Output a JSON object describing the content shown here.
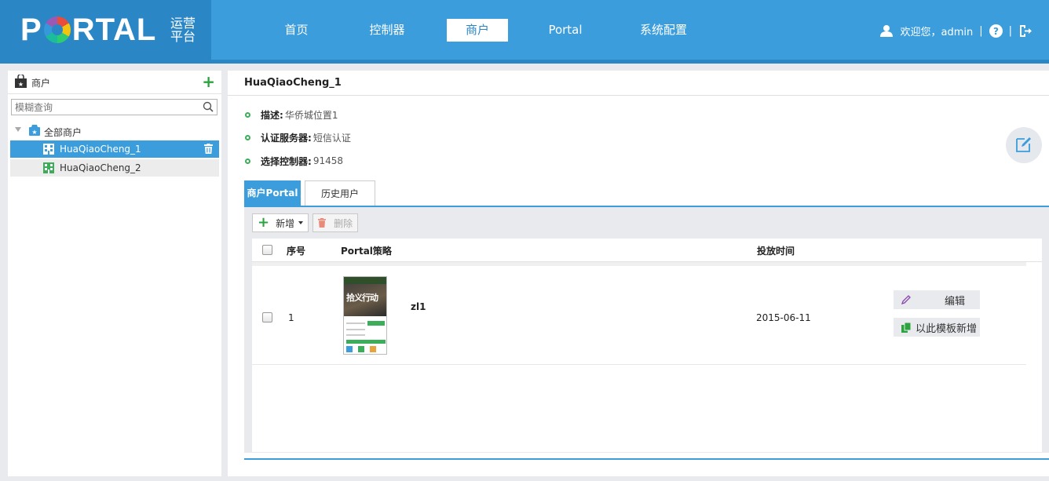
{
  "header": {
    "logo": {
      "main_left": "P",
      "main_right": "RTAL",
      "sub_line1": "运营",
      "sub_line2": "平台"
    },
    "nav": [
      {
        "label": "首页",
        "active": false
      },
      {
        "label": "控制器",
        "active": false
      },
      {
        "label": "商户",
        "active": true
      },
      {
        "label": "Portal",
        "active": false
      },
      {
        "label": "系统配置",
        "active": false
      }
    ],
    "user": {
      "greeting": "欢迎您，admin",
      "separator": "|"
    }
  },
  "sidebar": {
    "title": "商户",
    "search_placeholder": "模糊查询",
    "root_label": "全部商户",
    "items": [
      {
        "label": "HuaQiaoCheng_1",
        "selected": true
      },
      {
        "label": "HuaQiaoCheng_2",
        "selected": false
      }
    ]
  },
  "detail": {
    "title": "HuaQiaoCheng_1",
    "fields": [
      {
        "key": "描述:",
        "value": "华侨城位置1"
      },
      {
        "key": "认证服务器:",
        "value": "短信认证"
      },
      {
        "key": "选择控制器:",
        "value": "91458"
      }
    ],
    "tabs": [
      {
        "label": "商户Portal",
        "active": true
      },
      {
        "label": "历史用户",
        "active": false
      }
    ],
    "toolbar": {
      "add_label": "新增",
      "delete_label": "删除"
    },
    "table": {
      "columns": {
        "index": "序号",
        "policy": "Portal策略",
        "time": "投放时间"
      },
      "rows": [
        {
          "index": "1",
          "name": "zl1",
          "time": "2015-06-11",
          "thumb_text": "拾义行动",
          "actions": {
            "edit": "编辑",
            "copy": "以此模板新增"
          }
        }
      ]
    }
  },
  "colors": {
    "header_bg": "#3b9ddb",
    "logo_bg": "#2b86c5",
    "accent_green": "#2ca33f",
    "selected_bg": "#3b9ddb"
  }
}
